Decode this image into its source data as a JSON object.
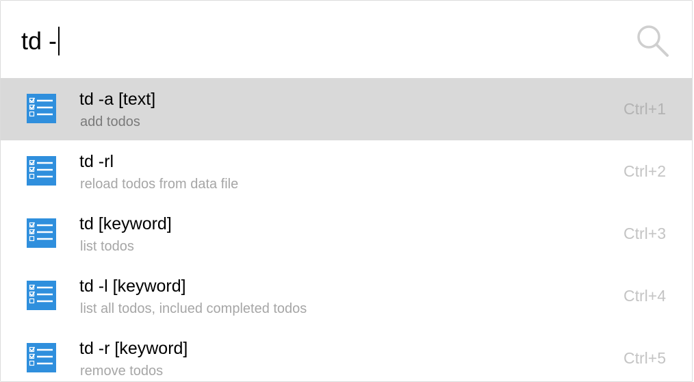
{
  "search": {
    "query": "td -"
  },
  "results": [
    {
      "icon": "todo-list-icon",
      "title": "td -a [text]",
      "subtitle": "add todos",
      "hotkey": "Ctrl+1",
      "selected": true
    },
    {
      "icon": "todo-list-icon",
      "title": "td -rl",
      "subtitle": "reload todos from data file",
      "hotkey": "Ctrl+2",
      "selected": false
    },
    {
      "icon": "todo-list-icon",
      "title": "td [keyword]",
      "subtitle": "list todos",
      "hotkey": "Ctrl+3",
      "selected": false
    },
    {
      "icon": "todo-list-icon",
      "title": "td -l [keyword]",
      "subtitle": "list all todos, inclued completed todos",
      "hotkey": "Ctrl+4",
      "selected": false
    },
    {
      "icon": "todo-list-icon",
      "title": "td -r [keyword]",
      "subtitle": "remove todos",
      "hotkey": "Ctrl+5",
      "selected": false
    }
  ],
  "colors": {
    "selected_background": "#d9d9d9",
    "icon_blue": "#2f8fdd",
    "hotkey_gray": "#c4c4c4",
    "subtitle_gray": "#a6a6a6"
  }
}
